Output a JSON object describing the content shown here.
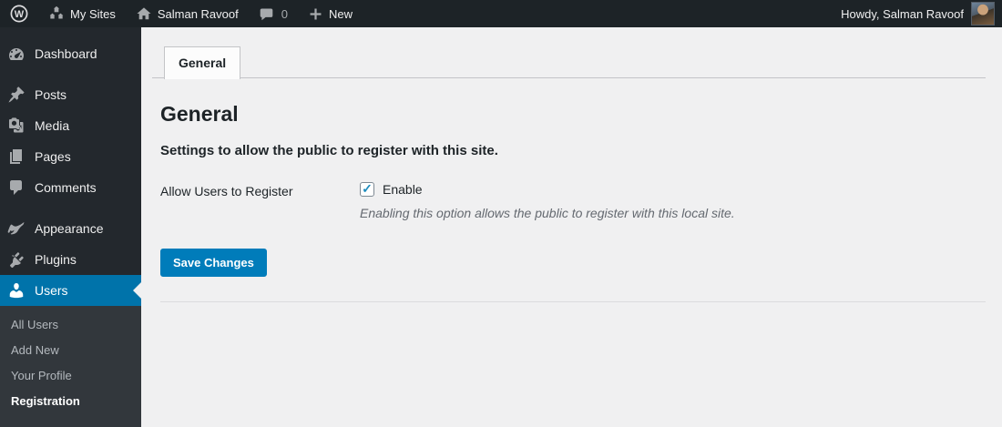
{
  "admin_bar": {
    "wp_logo_letter": "W",
    "my_sites_label": "My Sites",
    "site_name": "Salman Ravoof",
    "comments_count": "0",
    "new_label": "New",
    "howdy_label": "Howdy, Salman Ravoof"
  },
  "sidebar": {
    "items": [
      {
        "label": "Dashboard"
      },
      {
        "label": "Posts"
      },
      {
        "label": "Media"
      },
      {
        "label": "Pages"
      },
      {
        "label": "Comments"
      },
      {
        "label": "Appearance"
      },
      {
        "label": "Plugins"
      },
      {
        "label": "Users",
        "active": true
      }
    ],
    "submenu": [
      {
        "label": "All Users"
      },
      {
        "label": "Add New"
      },
      {
        "label": "Your Profile"
      },
      {
        "label": "Registration",
        "current": true
      }
    ]
  },
  "main": {
    "tab_label": "General",
    "heading": "General",
    "sub_heading": "Settings to allow the public to register with this site.",
    "field_label": "Allow Users to Register",
    "checkbox_label": "Enable",
    "checkbox_checked": true,
    "field_description": "Enabling this option allows the public to register with this local site.",
    "save_button_label": "Save Changes"
  },
  "colors": {
    "admin_bar_bg": "#1d2327",
    "sidebar_bg": "#23282d",
    "submenu_bg": "#32373c",
    "active_menu_blue": "#0073aa",
    "button_blue": "#007cba",
    "content_bg": "#f0f0f1",
    "checkmark_blue": "#1e8cbe",
    "muted_text": "#646970"
  }
}
